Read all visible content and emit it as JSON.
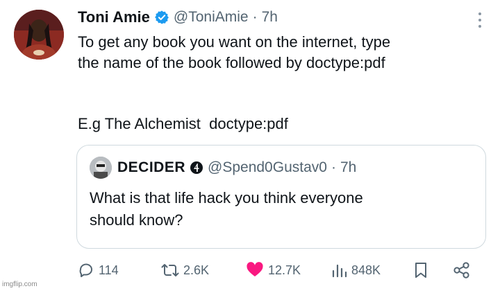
{
  "tweet": {
    "author_name": "Toni Amie",
    "handle": "@ToniAmie",
    "separator": "·",
    "time": "7h",
    "text_line1": "To get any book you want on the internet, type",
    "text_line2": "the name of the book followed by doctype:pdf",
    "example": "E.g The Alchemist  doctype:pdf"
  },
  "quote": {
    "author_name": "DECIDER",
    "handle": "@Spend0Gustav0",
    "separator": "·",
    "time": "7h",
    "text_line1": "What is that life hack you think everyone",
    "text_line2": "should know?"
  },
  "actions": {
    "replies": "114",
    "retweets": "2.6K",
    "likes": "12.7K",
    "views": "848K"
  },
  "watermark": "imgflip.com",
  "colors": {
    "verified": "#1d9bf0",
    "like": "#f91880",
    "secondary_text": "#536471",
    "border": "#cfd9de"
  },
  "icons": {
    "reply": "reply-icon",
    "retweet": "retweet-icon",
    "like": "heart-icon",
    "views": "views-icon",
    "bookmark": "bookmark-icon",
    "share": "share-icon",
    "more": "more-icon",
    "verified": "verified-icon"
  }
}
